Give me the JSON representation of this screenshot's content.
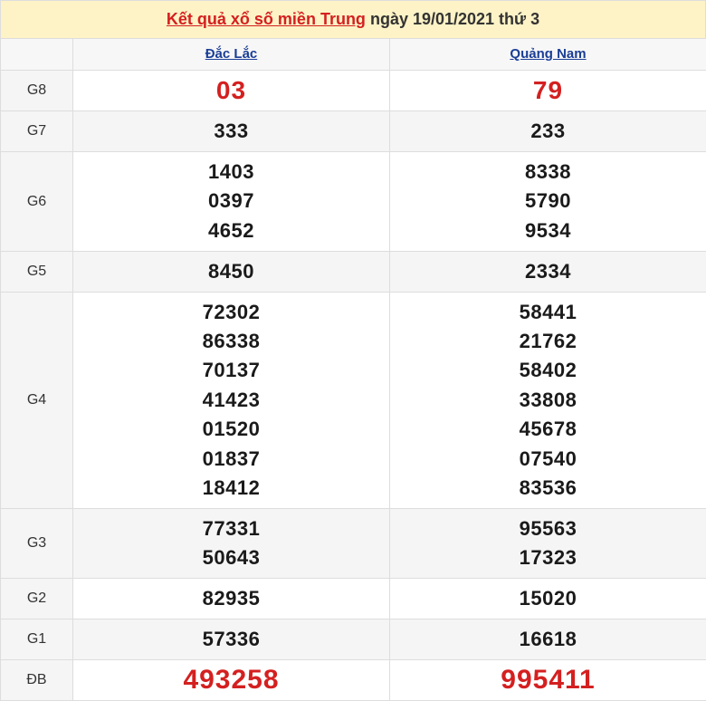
{
  "title": {
    "link_text": "Kết quả xổ số miền Trung",
    "rest_text": "ngày 19/01/2021 thứ 3"
  },
  "provinces": [
    "Đắc Lắc",
    "Quảng Nam"
  ],
  "prizes": [
    {
      "label": "G8",
      "col1": [
        "03"
      ],
      "col2": [
        "79"
      ]
    },
    {
      "label": "G7",
      "col1": [
        "333"
      ],
      "col2": [
        "233"
      ]
    },
    {
      "label": "G6",
      "col1": [
        "1403",
        "0397",
        "4652"
      ],
      "col2": [
        "8338",
        "5790",
        "9534"
      ]
    },
    {
      "label": "G5",
      "col1": [
        "8450"
      ],
      "col2": [
        "2334"
      ]
    },
    {
      "label": "G4",
      "col1": [
        "72302",
        "86338",
        "70137",
        "41423",
        "01520",
        "01837",
        "18412"
      ],
      "col2": [
        "58441",
        "21762",
        "58402",
        "33808",
        "45678",
        "07540",
        "83536"
      ]
    },
    {
      "label": "G3",
      "col1": [
        "77331",
        "50643"
      ],
      "col2": [
        "95563",
        "17323"
      ]
    },
    {
      "label": "G2",
      "col1": [
        "82935"
      ],
      "col2": [
        "15020"
      ]
    },
    {
      "label": "G1",
      "col1": [
        "57336"
      ],
      "col2": [
        "16618"
      ]
    },
    {
      "label": "ĐB",
      "col1": [
        "493258"
      ],
      "col2": [
        "995411"
      ]
    }
  ],
  "colors": {
    "accent_red": "#d42020",
    "link_blue": "#1a3e96",
    "title_bg": "#fdf3c6"
  }
}
